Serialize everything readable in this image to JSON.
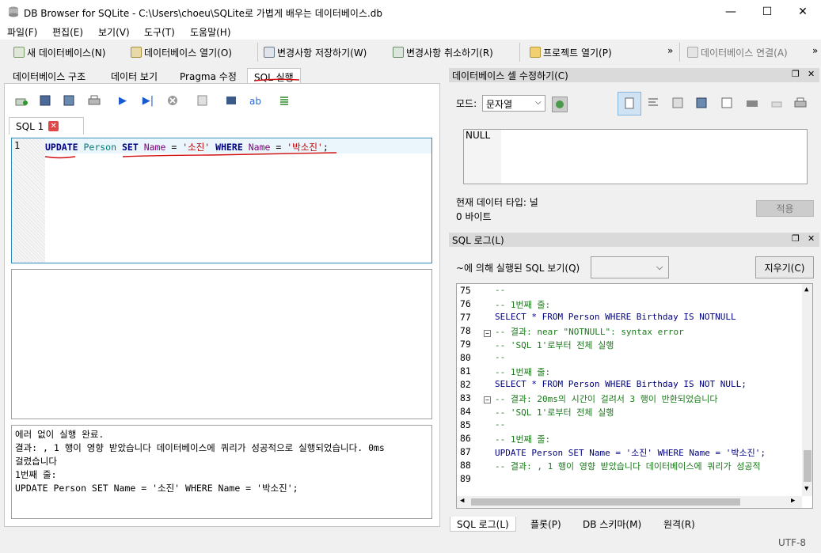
{
  "window": {
    "title": "DB Browser for SQLite - C:\\Users\\choeu\\SQLite로 가볍게 배우는 데이터베이스.db",
    "minimize": "—",
    "maximize": "☐",
    "close": "✕"
  },
  "menu": [
    "파일(F)",
    "편집(E)",
    "보기(V)",
    "도구(T)",
    "도움말(H)"
  ],
  "toolbar": {
    "new_db": "새 데이터베이스(N)",
    "open_db": "데이터베이스 열기(O)",
    "write_changes": "변경사항 저장하기(W)",
    "revert_changes": "변경사항 취소하기(R)",
    "open_project": "프로젝트 열기(P)",
    "attach_db": "데이터베이스 연결(A)",
    "more": "»"
  },
  "main_tabs": [
    "데이터베이스 구조",
    "데이터 보기",
    "Pragma 수정",
    "SQL 실행"
  ],
  "sql_tab": {
    "name": "SQL 1",
    "line_number": "1",
    "tokens": {
      "update": "UPDATE",
      "table": "Person",
      "set": "SET",
      "col1": "Name",
      "eq1": "=",
      "val1": "'소진'",
      "where": "WHERE",
      "col2": "Name",
      "eq2": "=",
      "val2": "'박소진'",
      "end": ";"
    }
  },
  "message": {
    "line1": "에러 없이 실행 완료.",
    "line2": "결과: , 1 행이 영향 받았습니다 데이터베이스에 쿼리가 성공적으로 실행되었습니다. 0ms",
    "line3": "걸렸습니다",
    "line4": "1번째 줄:",
    "line5": "UPDATE Person SET Name = '소진' WHERE Name = '박소진';"
  },
  "cell_editor": {
    "title": "데이터베이스 셀 수정하기(C)",
    "mode_label": "모드:",
    "mode_value": "문자열",
    "value": "NULL",
    "type_label": "현재 데이터 타입: 널",
    "size_label": "0 바이트",
    "apply": "적용"
  },
  "sql_log": {
    "title": "SQL 로그(L)",
    "by_label": "~에 의해 실행된 SQL 보기(Q)",
    "clear": "지우기(C)",
    "lines": [
      {
        "n": "75",
        "text": "--"
      },
      {
        "n": "76",
        "text": "-- 1번째 줄:"
      },
      {
        "n": "77",
        "text": "SELECT * FROM Person WHERE Birthday IS NOTNULL"
      },
      {
        "n": "78",
        "text": "-- 결과: near \"NOTNULL\": syntax error"
      },
      {
        "n": "79",
        "text": "-- 'SQL 1'로부터 전체 실행"
      },
      {
        "n": "80",
        "text": "--"
      },
      {
        "n": "81",
        "text": "-- 1번째 줄:"
      },
      {
        "n": "82",
        "text": "SELECT * FROM Person WHERE Birthday IS NOT NULL;"
      },
      {
        "n": "83",
        "text": "-- 결과: 20ms의 시간이 걸려서 3 행이 반환되었습니다"
      },
      {
        "n": "84",
        "text": "-- 'SQL 1'로부터 전체 실행"
      },
      {
        "n": "85",
        "text": "--"
      },
      {
        "n": "86",
        "text": "-- 1번째 줄:"
      },
      {
        "n": "87",
        "text": "UPDATE Person SET Name = '소진' WHERE Name = '박소진';"
      },
      {
        "n": "88",
        "text": "-- 결과: , 1 행이 영향 받았습니다 데이터베이스에 쿼리가 성공적"
      },
      {
        "n": "89",
        "text": ""
      }
    ]
  },
  "bottom_tabs": [
    "SQL 로그(L)",
    "플롯(P)",
    "DB 스키마(M)",
    "원격(R)"
  ],
  "status": {
    "encoding": "UTF-8"
  }
}
